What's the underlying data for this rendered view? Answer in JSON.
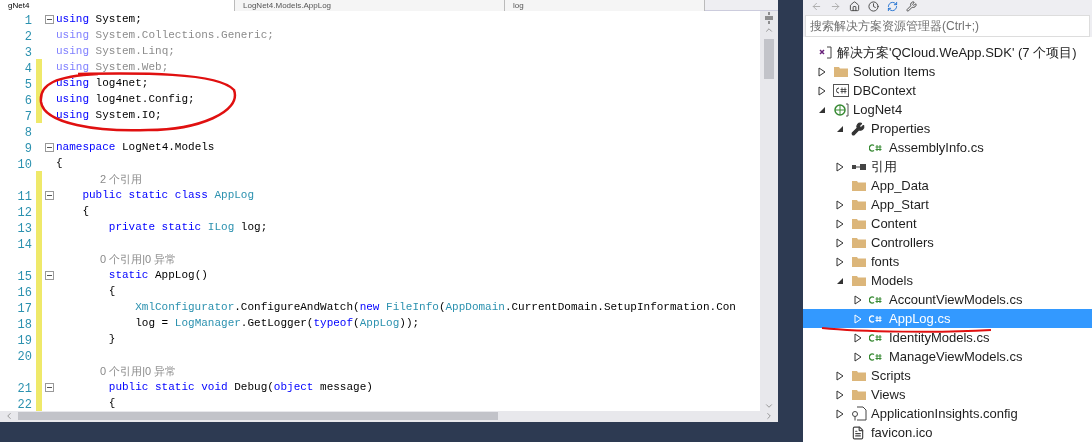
{
  "tabs": [
    {
      "label": "gNet4",
      "selected": true
    },
    {
      "label": "LogNet4.Models.AppLog",
      "selected": false
    },
    {
      "label": "log",
      "selected": false
    }
  ],
  "editor": {
    "lines": [
      {
        "kind": "code",
        "number": "1",
        "fold": true,
        "modified": false,
        "tokens": [
          {
            "t": "using",
            "kind": "keyword"
          },
          {
            "t": " System;",
            "kind": "plain"
          }
        ]
      },
      {
        "kind": "code",
        "number": "2",
        "fold": false,
        "modified": false,
        "tokens": [
          {
            "t": "using",
            "kind": "unused_keyword"
          },
          {
            "t": " System.Collections.Generic;",
            "kind": "unused"
          }
        ]
      },
      {
        "kind": "code",
        "number": "3",
        "fold": false,
        "modified": false,
        "tokens": [
          {
            "t": "using",
            "kind": "unused_keyword"
          },
          {
            "t": " System.Linq;",
            "kind": "unused"
          }
        ]
      },
      {
        "kind": "code",
        "number": "4",
        "fold": false,
        "modified": true,
        "tokens": [
          {
            "t": "using",
            "kind": "unused_keyword"
          },
          {
            "t": " System.Web;",
            "kind": "unused"
          }
        ]
      },
      {
        "kind": "code",
        "number": "5",
        "fold": false,
        "modified": true,
        "tokens": [
          {
            "t": "using",
            "kind": "keyword"
          },
          {
            "t": " log4net;",
            "kind": "plain"
          }
        ]
      },
      {
        "kind": "code",
        "number": "6",
        "fold": false,
        "modified": true,
        "tokens": [
          {
            "t": "using",
            "kind": "keyword"
          },
          {
            "t": " log4net.Config;",
            "kind": "plain"
          }
        ]
      },
      {
        "kind": "code",
        "number": "7",
        "fold": false,
        "modified": true,
        "tokens": [
          {
            "t": "using",
            "kind": "keyword"
          },
          {
            "t": " System.IO;",
            "kind": "plain"
          }
        ]
      },
      {
        "kind": "code",
        "number": "8",
        "fold": false,
        "modified": false
      },
      {
        "kind": "code",
        "number": "9",
        "fold": true,
        "modified": false,
        "tokens": [
          {
            "t": "namespace",
            "kind": "keyword"
          },
          {
            "t": " LogNet4.Models",
            "kind": "plain"
          }
        ]
      },
      {
        "kind": "code",
        "number": "10",
        "fold": false,
        "modified": false,
        "tokens": [
          {
            "t": "{",
            "kind": "plain"
          }
        ]
      },
      {
        "kind": "lens",
        "modified": true,
        "text": "2 个引用"
      },
      {
        "kind": "code",
        "number": "11",
        "fold": true,
        "modified": true,
        "tokens": [
          {
            "t": "    public static class ",
            "kind": "keyword"
          },
          {
            "t": "AppLog",
            "kind": "type"
          }
        ]
      },
      {
        "kind": "code",
        "number": "12",
        "fold": false,
        "modified": true,
        "tokens": [
          {
            "t": "    {",
            "kind": "plain"
          }
        ]
      },
      {
        "kind": "code",
        "number": "13",
        "fold": false,
        "modified": true,
        "tokens": [
          {
            "t": "        private static ",
            "kind": "keyword"
          },
          {
            "t": "ILog",
            "kind": "type"
          },
          {
            "t": " log;",
            "kind": "plain"
          }
        ]
      },
      {
        "kind": "code",
        "number": "14",
        "fold": false,
        "modified": true
      },
      {
        "kind": "lens",
        "modified": true,
        "text": "0 个引用|0 异常"
      },
      {
        "kind": "code",
        "number": "15",
        "fold": true,
        "modified": true,
        "tokens": [
          {
            "t": "        static",
            "kind": "keyword"
          },
          {
            "t": " AppLog()",
            "kind": "plain"
          }
        ]
      },
      {
        "kind": "code",
        "number": "16",
        "fold": false,
        "modified": true,
        "tokens": [
          {
            "t": "        {",
            "kind": "plain"
          }
        ]
      },
      {
        "kind": "code",
        "number": "17",
        "fold": false,
        "modified": true,
        "tokens": [
          {
            "t": "            XmlConfigurator",
            "kind": "type"
          },
          {
            "t": ".ConfigureAndWatch(",
            "kind": "plain"
          },
          {
            "t": "new ",
            "kind": "keyword"
          },
          {
            "t": "FileInfo",
            "kind": "type"
          },
          {
            "t": "(",
            "kind": "plain"
          },
          {
            "t": "AppDomain",
            "kind": "type"
          },
          {
            "t": ".CurrentDomain.SetupInformation.Con",
            "kind": "plain"
          }
        ]
      },
      {
        "kind": "code",
        "number": "18",
        "fold": false,
        "modified": true,
        "tokens": [
          {
            "t": "            log = ",
            "kind": "plain"
          },
          {
            "t": "LogManager",
            "kind": "type"
          },
          {
            "t": ".GetLogger(",
            "kind": "plain"
          },
          {
            "t": "typeof",
            "kind": "keyword"
          },
          {
            "t": "(",
            "kind": "plain"
          },
          {
            "t": "AppLog",
            "kind": "type"
          },
          {
            "t": "));",
            "kind": "plain"
          }
        ]
      },
      {
        "kind": "code",
        "number": "19",
        "fold": false,
        "modified": true,
        "tokens": [
          {
            "t": "        }",
            "kind": "plain"
          }
        ]
      },
      {
        "kind": "code",
        "number": "20",
        "fold": false,
        "modified": true
      },
      {
        "kind": "lens",
        "modified": true,
        "text": "0 个引用|0 异常"
      },
      {
        "kind": "code",
        "number": "21",
        "fold": true,
        "modified": true,
        "tokens": [
          {
            "t": "        public static void",
            "kind": "keyword"
          },
          {
            "t": " Debug(",
            "kind": "plain"
          },
          {
            "t": "object",
            "kind": "keyword"
          },
          {
            "t": " message)",
            "kind": "plain"
          }
        ]
      },
      {
        "kind": "code",
        "number": "22",
        "fold": false,
        "modified": true,
        "tokens": [
          {
            "t": "        {",
            "kind": "plain"
          }
        ]
      }
    ]
  },
  "solution_explorer": {
    "search": {
      "placeholder": "搜索解决方案资源管理器(Ctrl+;)"
    },
    "solution": {
      "label": "解决方案'QCloud.WeApp.SDK' (7 个项目)",
      "children": [
        {
          "label": "Solution Items",
          "kind": "folder",
          "expanded": false,
          "selected": false
        },
        {
          "label": "DBContext",
          "kind": "project",
          "expanded": false,
          "selected": false
        },
        {
          "label": "LogNet4",
          "kind": "web_project",
          "expanded": true,
          "selected": false,
          "children": [
            {
              "label": "Properties",
              "kind": "properties",
              "expanded": true,
              "selected": false,
              "children": [
                {
                  "label": "AssemblyInfo.cs",
                  "kind": "source",
                  "selected": false
                }
              ]
            },
            {
              "label": "引用",
              "kind": "references",
              "expanded": false,
              "selected": false
            },
            {
              "label": "App_Data",
              "kind": "folder",
              "selected": false
            },
            {
              "label": "App_Start",
              "kind": "folder",
              "expanded": false,
              "selected": false
            },
            {
              "label": "Content",
              "kind": "folder",
              "expanded": false,
              "selected": false
            },
            {
              "label": "Controllers",
              "kind": "folder",
              "expanded": false,
              "selected": false
            },
            {
              "label": "fonts",
              "kind": "folder",
              "expanded": false,
              "selected": false
            },
            {
              "label": "Models",
              "kind": "folder",
              "expanded": true,
              "selected": false,
              "children": [
                {
                  "label": "AccountViewModels.cs",
                  "kind": "source",
                  "expanded": false,
                  "selected": false
                },
                {
                  "label": "AppLog.cs",
                  "kind": "source",
                  "expanded": false,
                  "selected": true
                },
                {
                  "label": "IdentityModels.cs",
                  "kind": "source",
                  "expanded": false,
                  "selected": false
                },
                {
                  "label": "ManageViewModels.cs",
                  "kind": "source",
                  "expanded": false,
                  "selected": false
                }
              ]
            },
            {
              "label": "Scripts",
              "kind": "folder",
              "expanded": false,
              "selected": false
            },
            {
              "label": "Views",
              "kind": "folder",
              "expanded": false,
              "selected": false
            },
            {
              "label": "ApplicationInsights.config",
              "kind": "config",
              "expanded": false,
              "selected": false
            },
            {
              "label": "favicon.ico",
              "kind": "file",
              "selected": false
            }
          ]
        }
      ]
    }
  }
}
